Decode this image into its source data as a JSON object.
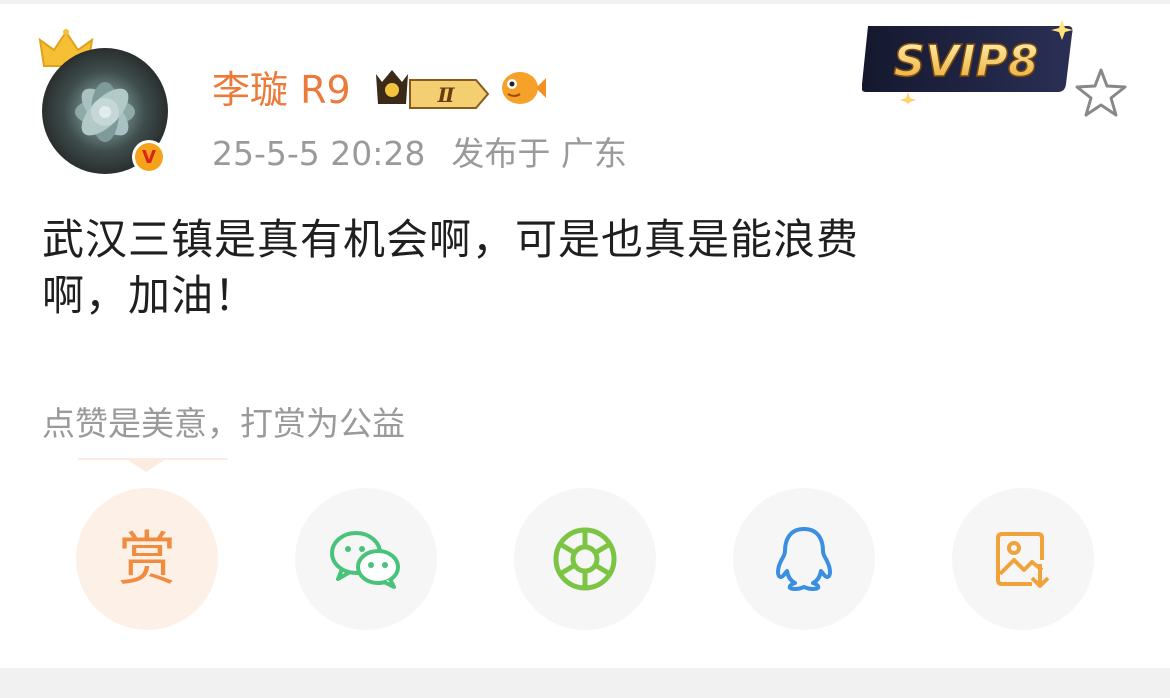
{
  "user": {
    "name": "李璇 R9",
    "level_badge": "Ⅱ",
    "verified_badge": "V"
  },
  "post": {
    "timestamp": "25-5-5 20:28",
    "location": "发布于 广东",
    "text_lines": [
      "武汉三镇是真有机会啊，可是也真是能浪费",
      "啊，加油！"
    ]
  },
  "vip_badge": "SVIP8",
  "tip": {
    "text": "点赞是美意，打赏为公益"
  },
  "share": {
    "reward_label": "赏",
    "icons": [
      "reward-icon",
      "wechat-icon",
      "moments-icon",
      "qq-icon",
      "save-image-icon"
    ]
  },
  "colors": {
    "username": "#eb7b3a",
    "meta_gray": "#9a9a9a",
    "reward_orange": "#f08b3f",
    "wechat_green": "#49c27a",
    "moments_green": "#7cc544",
    "qq_blue": "#3b8fe0",
    "save_orange": "#f0a33a"
  }
}
